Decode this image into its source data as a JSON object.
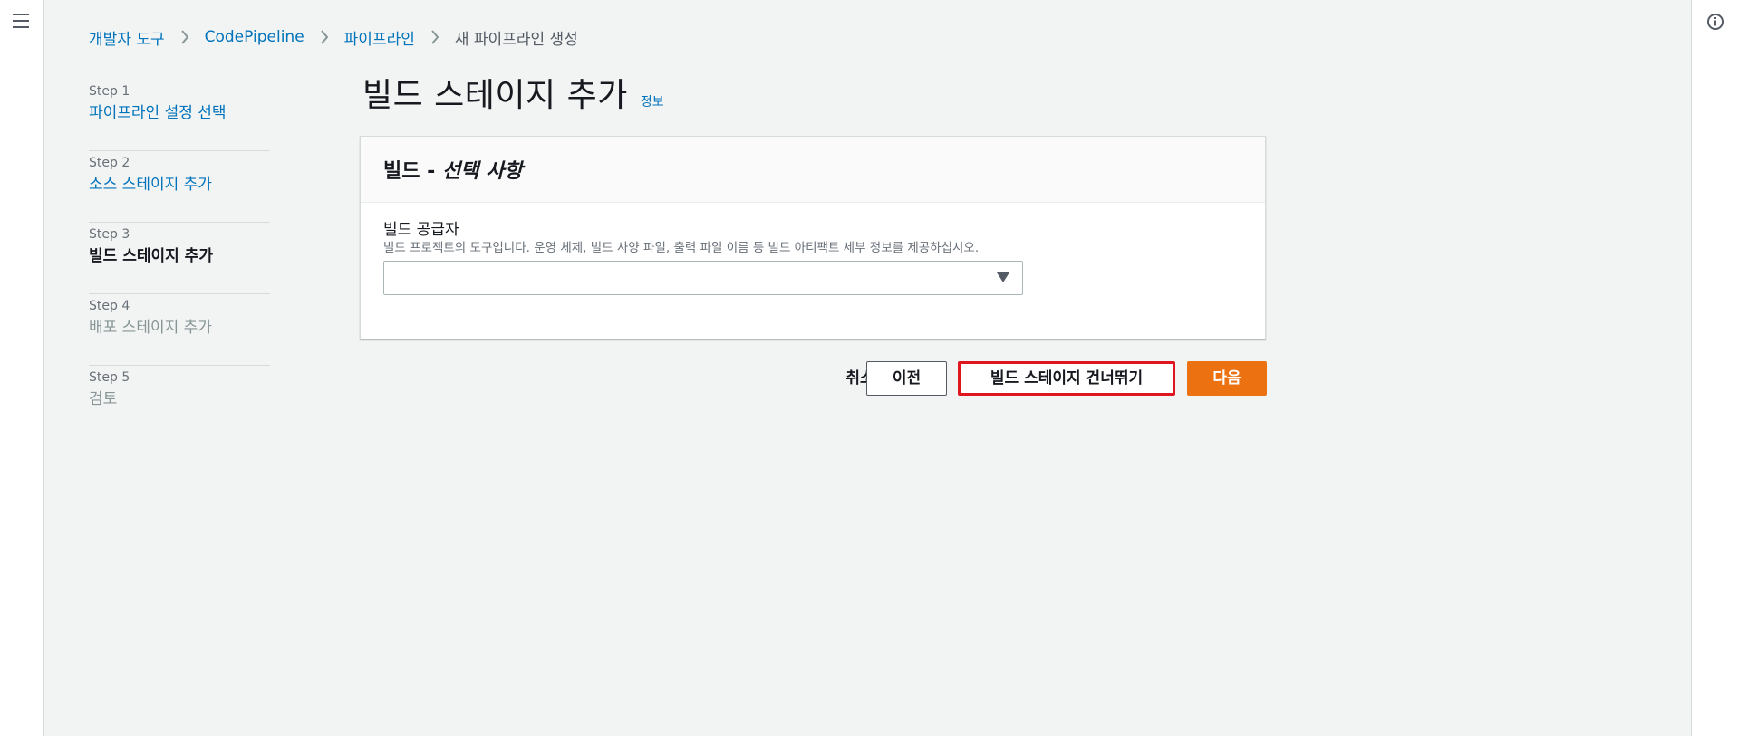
{
  "breadcrumb": [
    {
      "label": "개발자 도구",
      "type": "link"
    },
    {
      "label": "CodePipeline",
      "type": "link"
    },
    {
      "label": "파이프라인",
      "type": "link"
    },
    {
      "label": "새 파이프라인 생성",
      "type": "current"
    }
  ],
  "steps": [
    {
      "num": "Step 1",
      "label": "파이프라인 설정 선택",
      "state": "link"
    },
    {
      "num": "Step 2",
      "label": "소스 스테이지 추가",
      "state": "link"
    },
    {
      "num": "Step 3",
      "label": "빌드 스테이지 추가",
      "state": "active"
    },
    {
      "num": "Step 4",
      "label": "배포 스테이지 추가",
      "state": "disabled"
    },
    {
      "num": "Step 5",
      "label": "검토",
      "state": "disabled"
    }
  ],
  "page": {
    "title": "빌드 스테이지 추가",
    "info_link": "정보"
  },
  "card": {
    "title_prefix": "빌드 - ",
    "title_optional": "선택 사항",
    "field_label": "빌드 공급자",
    "field_description": "빌드 프로젝트의 도구입니다. 운영 체제, 빌드 사양 파일, 출력 파일 이름 등 빌드 아티팩트 세부 정보를 제공하십시오.",
    "select_value": ""
  },
  "actions": {
    "cancel": "취소",
    "previous": "이전",
    "skip": "빌드 스테이지 건너뛰기",
    "next": "다음"
  },
  "colors": {
    "link": "#0073bb",
    "primary_button": "#ec7211",
    "highlight_border": "#e0161e",
    "background": "#f2f3f3"
  },
  "icons": {
    "menu": "hamburger-menu-icon",
    "help": "info-circle-icon",
    "breadcrumb_separator": "chevron-right-icon",
    "select_arrow": "caret-down-icon"
  }
}
